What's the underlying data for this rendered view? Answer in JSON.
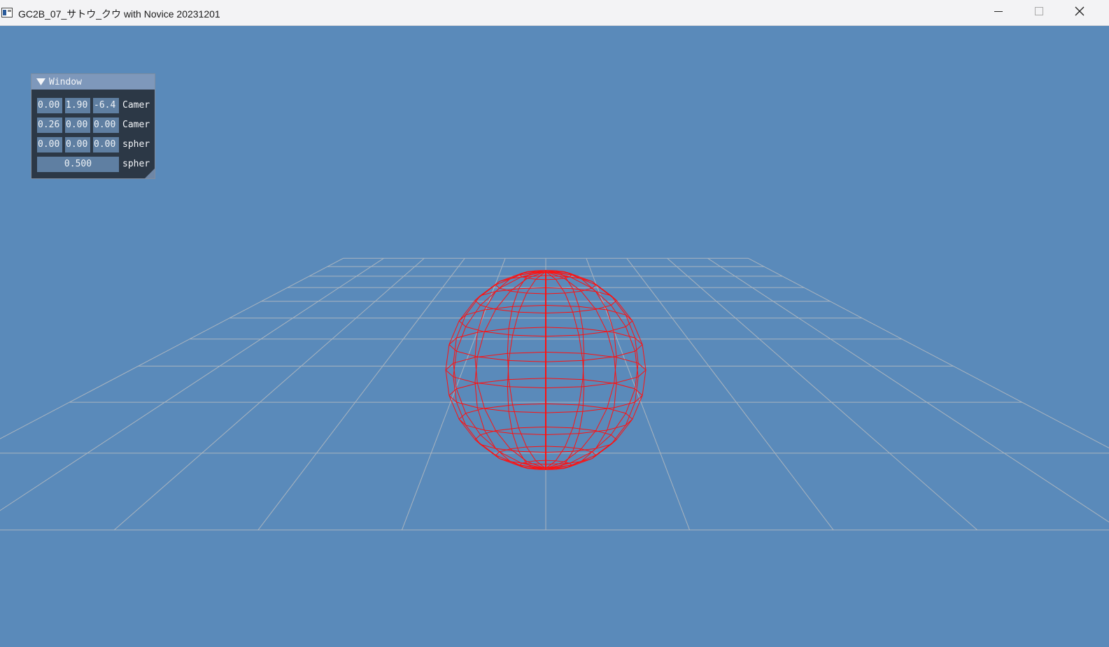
{
  "window": {
    "title": "GC2B_07_サトウ_クウ with Novice 20231201",
    "buttons": {
      "minimize": "minimize-icon",
      "maximize": "maximize-icon",
      "close": "close-icon"
    }
  },
  "scene": {
    "background_color": "#5a8aba",
    "grid_color": "#a9b4bf",
    "sphere_color": "#ff1010"
  },
  "imgui": {
    "title": "Window",
    "rows": [
      {
        "values": [
          "0.00",
          "1.90",
          "-6.4"
        ],
        "label": "Camer"
      },
      {
        "values": [
          "0.26",
          "0.00",
          "0.00"
        ],
        "label": "Camer"
      },
      {
        "values": [
          "0.00",
          "0.00",
          "0.00"
        ],
        "label": "spher"
      },
      {
        "values": [
          "0.500"
        ],
        "label": "spher"
      }
    ]
  }
}
